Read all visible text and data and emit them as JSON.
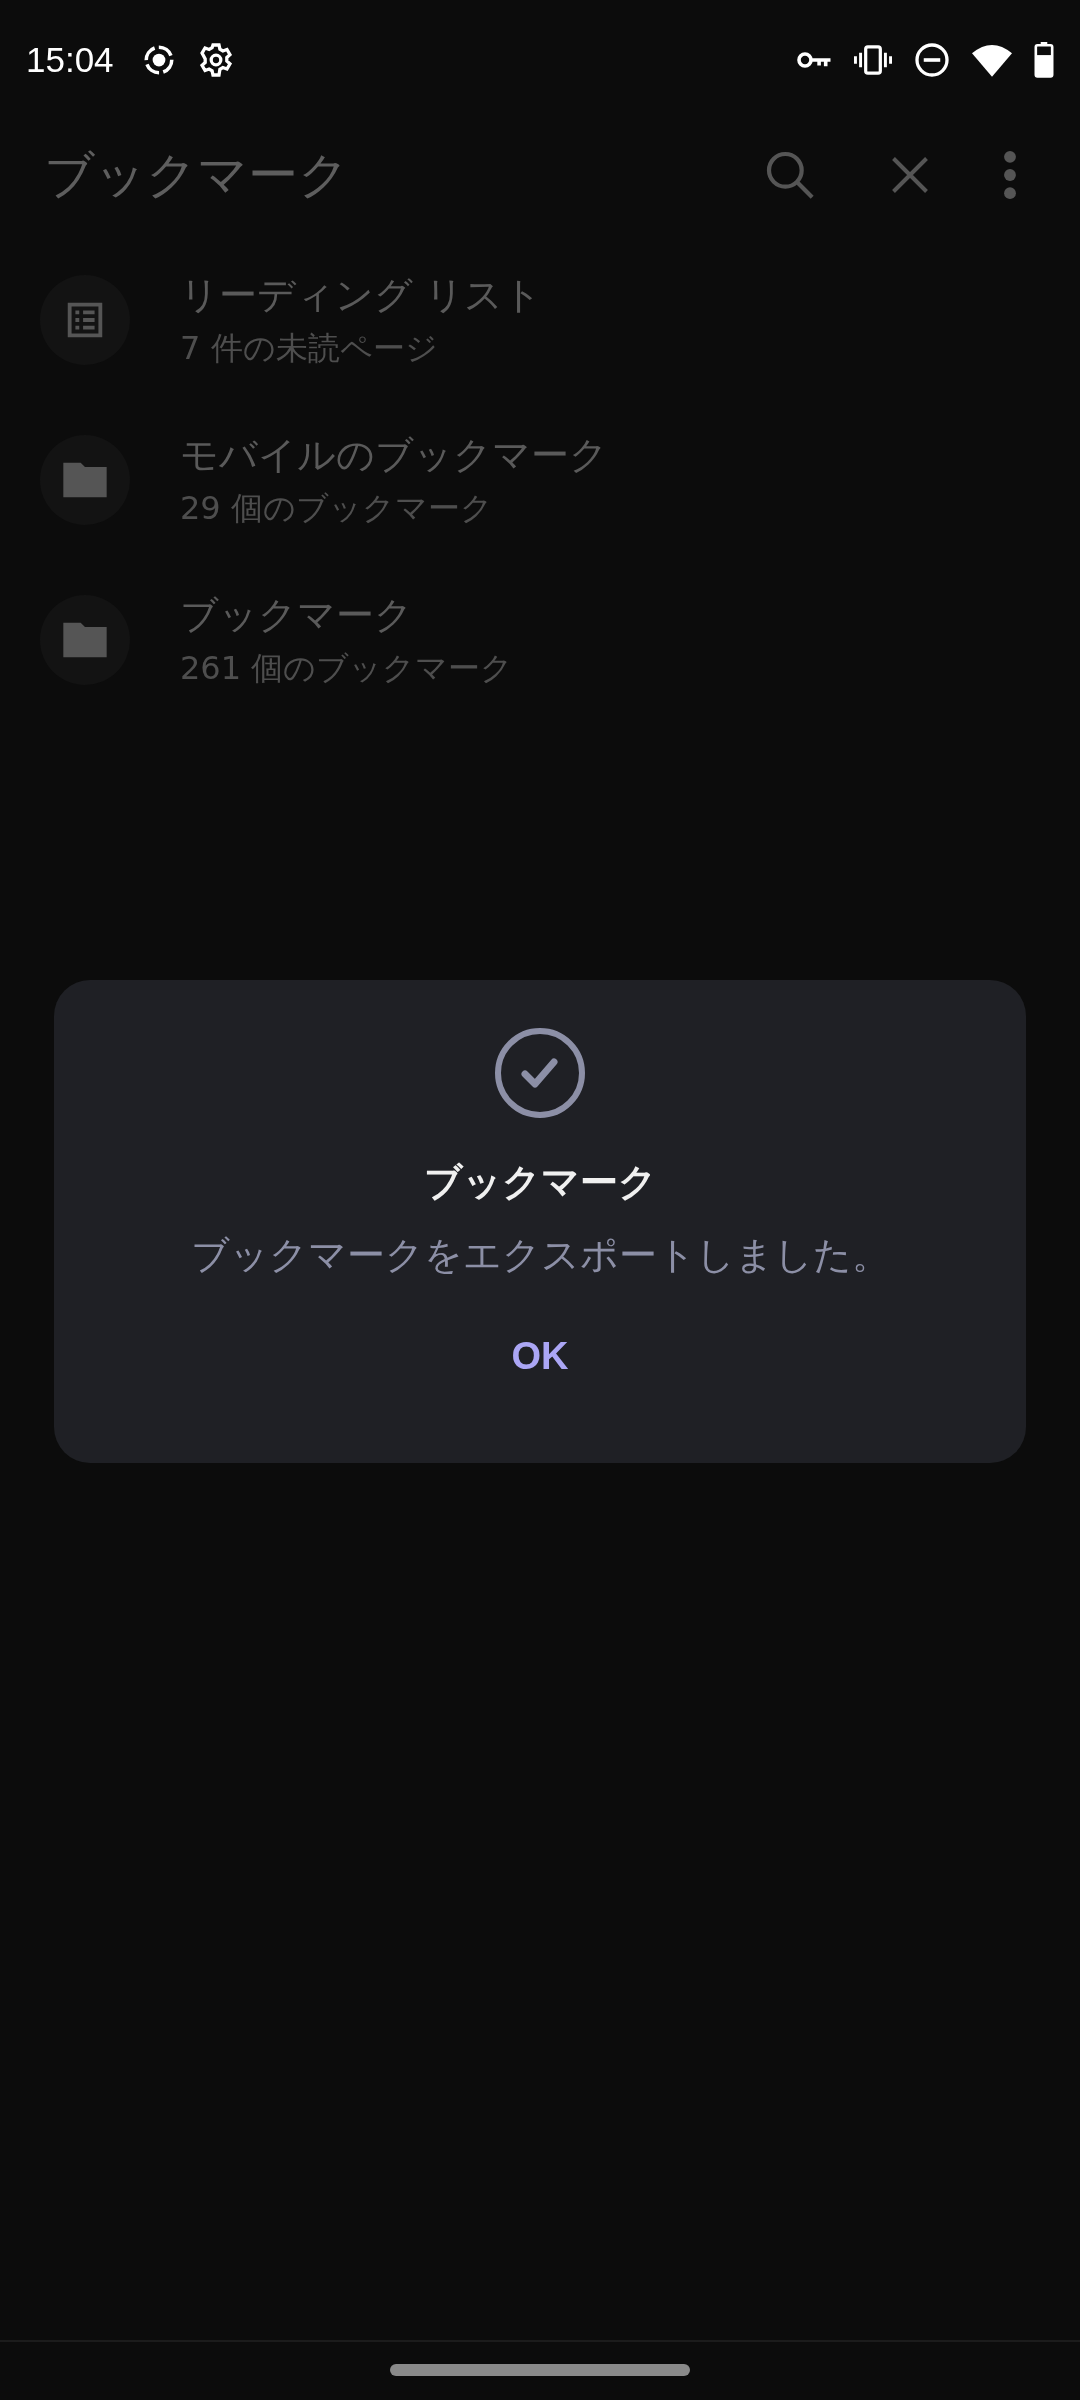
{
  "status_bar": {
    "time": "15:04"
  },
  "app_bar": {
    "title": "ブックマーク"
  },
  "items": [
    {
      "kind": "list",
      "title": "リーディング リスト",
      "subtitle": "7 件の未読ページ"
    },
    {
      "kind": "folder",
      "title": "モバイルのブックマーク",
      "subtitle": "29 個のブックマーク"
    },
    {
      "kind": "folder",
      "title": "ブックマーク",
      "subtitle": "261 個のブックマーク"
    }
  ],
  "dialog": {
    "title": "ブックマーク",
    "message": "ブックマークをエクスポートしました。",
    "button": "OK"
  }
}
